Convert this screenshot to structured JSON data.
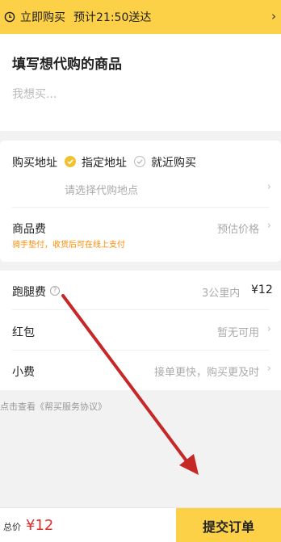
{
  "topbar": {
    "mode": "立即购买",
    "eta": "预计21:50送达",
    "icon": "clock-icon",
    "chevron": "›"
  },
  "item": {
    "title": "填写想代购的商品",
    "placeholder": "我想买..."
  },
  "address": {
    "label": "购买地址",
    "option_selected": "指定地址",
    "option_other": "就近购买",
    "select_hint": "请选择代购地点"
  },
  "goods_fee": {
    "label": "商品费",
    "estimate": "预估价格",
    "note": "骑手垫付，收货后可在线上支付"
  },
  "errand_fee": {
    "label": "跑腿费",
    "distance": "3公里内",
    "price": "¥12"
  },
  "coupon": {
    "label": "红包",
    "value": "暂无可用"
  },
  "tip": {
    "label": "小费",
    "hint": "接单更快，购买更及时"
  },
  "agreement": "点击查看《帮买服务协议》",
  "bottom": {
    "total_label": "总价",
    "total_price": "¥12",
    "submit_label": "提交订单"
  },
  "colors": {
    "accent": "#fcd047",
    "price_red": "#e02e2e",
    "note_orange": "#ff8a00",
    "arrow_red": "#c62828"
  }
}
